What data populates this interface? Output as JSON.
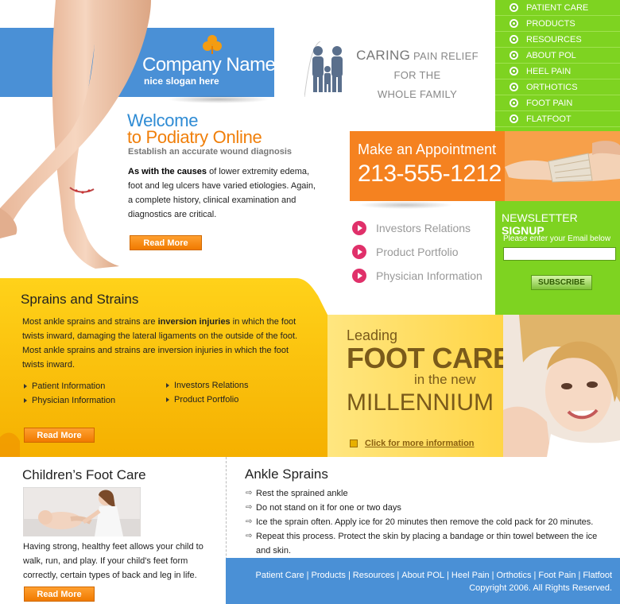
{
  "brand": {
    "company_name": "Company Name",
    "slogan": "nice slogan here"
  },
  "welcome": {
    "line1": "Welcome",
    "line2": "to Podiatry Online",
    "subtitle": "Establish an accurate wound diagnosis",
    "lead_bold": "As with the causes",
    "body": " of lower extremity edema, foot and leg ulcers have varied etiologies. Again, a complete history, clinical examination and diagnostics are critical.",
    "read_more": "Read More"
  },
  "tagline": {
    "caring": "CARING",
    "pain_relief": " PAIN RELIEF",
    "line2": "FOR THE",
    "line3": "WHOLE FAMILY"
  },
  "nav": {
    "items": [
      {
        "label": "PATIENT CARE"
      },
      {
        "label": "PRODUCTS"
      },
      {
        "label": "RESOURCES"
      },
      {
        "label": "ABOUT POL"
      },
      {
        "label": "HEEL PAIN"
      },
      {
        "label": "ORTHOTICS"
      },
      {
        "label": "FOOT PAIN"
      },
      {
        "label": "FLATFOOT"
      }
    ]
  },
  "appointment": {
    "title": "Make an Appointment",
    "phone": "213-555-1212"
  },
  "quick_links": [
    {
      "label": "Investors Relations"
    },
    {
      "label": "Product Portfolio"
    },
    {
      "label": "Physician Information"
    }
  ],
  "newsletter": {
    "title_plain": "NEWSLETTER ",
    "title_bold": "SIGNUP",
    "label": "Please enter your Email below",
    "email_value": "",
    "button": "SUBSCRIBE"
  },
  "sprains": {
    "title": "Sprains and Strains",
    "text_a": "Most ankle sprains and strains are ",
    "text_bold": "inversion injuries",
    "text_b": " in which the foot twists inward, damaging the lateral ligaments on the outside of the foot. Most ankle sprains and strains are inversion injuries in which the foot twists inward.",
    "bullets": [
      {
        "label": "Patient Information"
      },
      {
        "label": "Physician Information"
      },
      {
        "label": "Investors Relations"
      },
      {
        "label": "Product Portfolio"
      }
    ],
    "read_more": "Read More"
  },
  "promo": {
    "leading": "Leading",
    "foot_care": "FOOT CARE",
    "in_the_new": "in the new",
    "millennium": "MILLENNIUM",
    "click_more": "Click for more information"
  },
  "kids": {
    "title": "Children’s Foot Care",
    "body": "Having strong, healthy feet allows your child to walk, run, and play. If your child's feet form correctly, certain types of back and leg in life.",
    "read_more": "Read More"
  },
  "ankle": {
    "title": "Ankle Sprains",
    "items": [
      "Rest the sprained ankle",
      "Do not stand on it for one or two days",
      "Ice the sprain often. Apply ice for 20 minutes then remove the cold pack for 20 minutes.",
      "Repeat this process. Protect the skin by placing a bandage or thin towel between the ice and skin."
    ]
  },
  "footer": {
    "links": [
      "Patient Care",
      "Products",
      "Resources",
      "About POL",
      "Heel Pain",
      "Orthotics",
      "Foot Pain",
      "Flatfoot"
    ],
    "separator": "|",
    "copyright": "Copyright 2006. All Rights Reserved."
  },
  "colors": {
    "blue": "#4a90d6",
    "green": "#7ed321",
    "orange": "#f58220",
    "yellow": "#f5b800"
  }
}
